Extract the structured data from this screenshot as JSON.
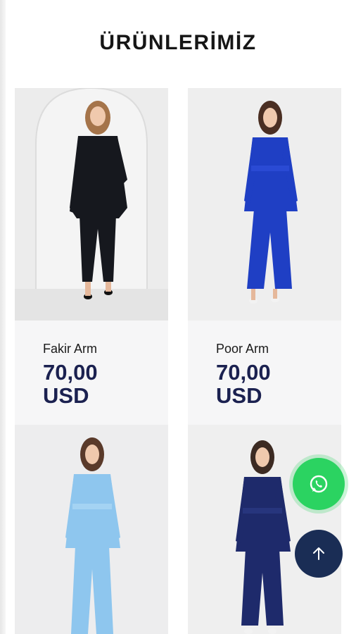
{
  "page": {
    "title": "ÜRÜNLERİMİZ"
  },
  "products": [
    {
      "name": "Fakir Arm",
      "price": "70,00",
      "currency": "USD",
      "suit_color": "#16181e"
    },
    {
      "name": "Poor Arm",
      "price": "70,00",
      "currency": "USD",
      "suit_color": "#1f3fc4"
    },
    {
      "suit_color": "#8ec6ee"
    },
    {
      "suit_color": "#1e2a6b"
    }
  ],
  "fab": {
    "whatsapp_icon": "whatsapp-icon",
    "whatsapp_color": "#2bd361",
    "scroll_top_icon": "arrow-up-icon",
    "scroll_top_color": "#1a2d55"
  }
}
